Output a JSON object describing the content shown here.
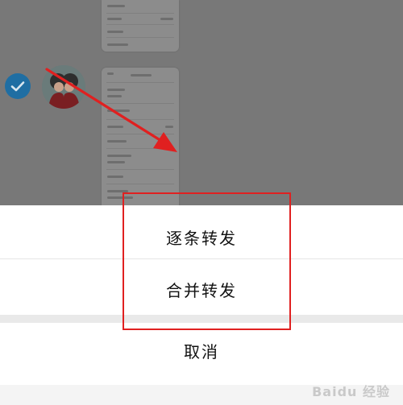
{
  "background": {
    "dim_color": "#787878",
    "check_icon": "check-icon",
    "avatar_icon": "avatar-icon"
  },
  "action_sheet": {
    "option_forward_one_by_one": "逐条转发",
    "option_merge_forward": "合并转发",
    "cancel_label": "取消"
  },
  "annotation": {
    "highlight_color": "#e02020",
    "arrow_color": "#e02020"
  },
  "watermark": {
    "text": "Baidu 经验"
  }
}
